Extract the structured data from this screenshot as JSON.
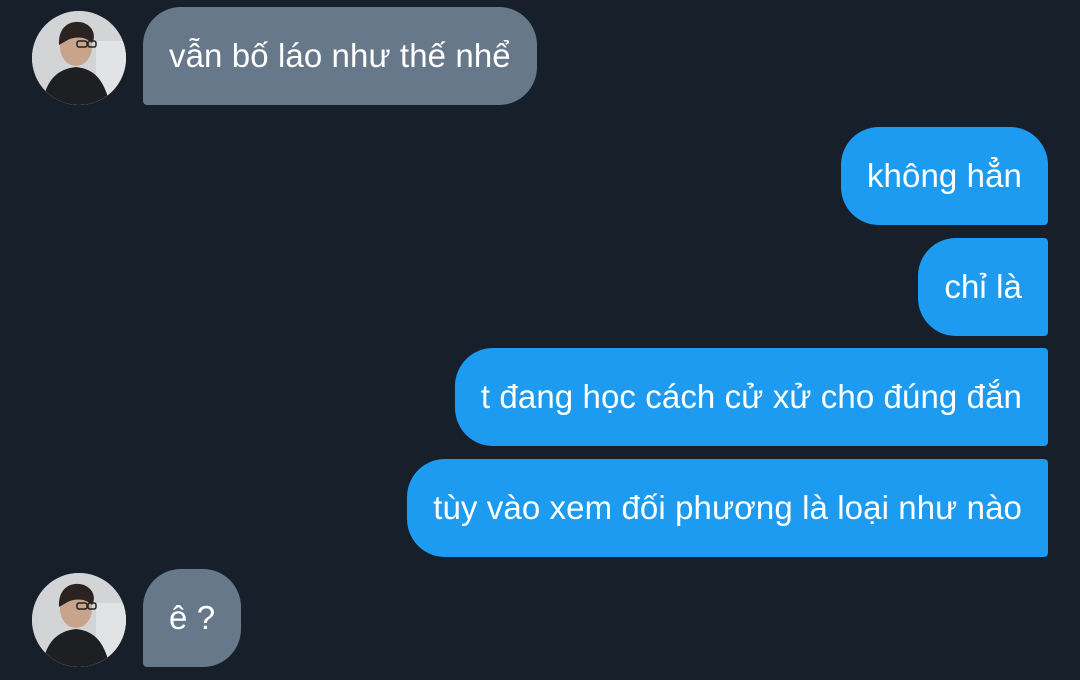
{
  "conversation": {
    "messages": [
      {
        "direction": "incoming",
        "text": "vẫn bố láo như thế nhể"
      },
      {
        "direction": "outgoing",
        "text": "không hẳn"
      },
      {
        "direction": "outgoing",
        "text": "chỉ là"
      },
      {
        "direction": "outgoing",
        "text": "t đang học cách cử xử cho đúng đắn"
      },
      {
        "direction": "outgoing",
        "text": "tùy vào xem đối phương là loại như nào"
      },
      {
        "direction": "incoming",
        "text": "ê ?"
      }
    ]
  },
  "colors": {
    "background": "#17202a",
    "incoming_bubble": "#66788a",
    "outgoing_bubble": "#1d9bf0",
    "text": "#ffffff"
  }
}
